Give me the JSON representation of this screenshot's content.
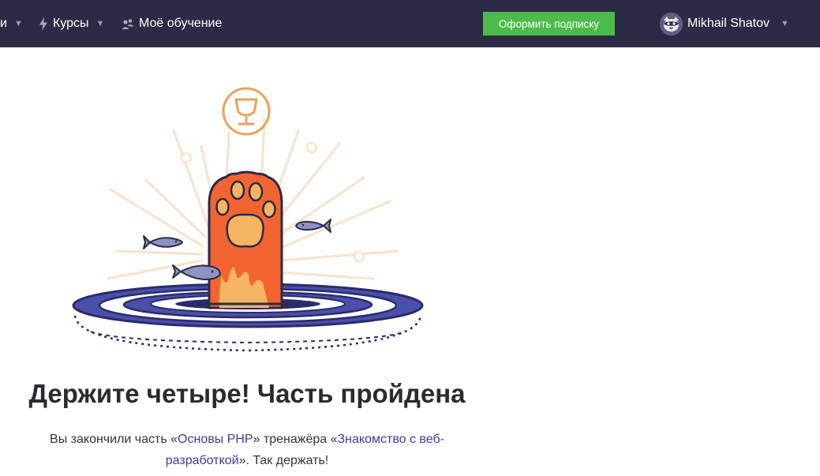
{
  "nav": {
    "partial_item": "и",
    "courses_label": "Курсы",
    "my_learning_label": "Моё обучение",
    "subscribe_label": "Оформить подписку",
    "user_name": "Mikhail Shatov",
    "caret_glyph": "▼"
  },
  "icons": [
    "bolt-icon",
    "people-icon",
    "avatar-image",
    "trophy-icon",
    "cat-paw",
    "fish"
  ],
  "colors": {
    "topbar": "#2b2b45",
    "cta": "#4cbb4a",
    "paw": "#f26532",
    "pad": "#f6b561",
    "trophy": "#e8a25d",
    "ring_navy": "#2b2b6b",
    "ring_blue": "#4a4fa8",
    "link": "#3c3c9c"
  },
  "main": {
    "title": "Держите четыре! Часть пройдена",
    "text_1": "Вы закончили часть «",
    "link_part": "Основы PHP",
    "text_2": "» тренажёра «",
    "link_trainer": "Знакомство с веб-разработкой",
    "text_3": "». Так держать!"
  }
}
